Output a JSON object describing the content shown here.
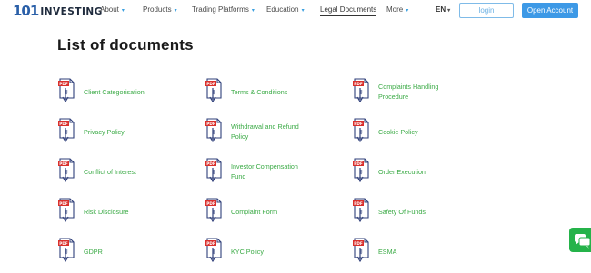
{
  "brand": {
    "number": "101",
    "word": "INVESTING"
  },
  "nav": [
    {
      "label": "About",
      "caret": "▾"
    },
    {
      "label": "Products",
      "caret": "▾"
    },
    {
      "label": "Trading Platforms",
      "caret": "▾"
    },
    {
      "label": "Education",
      "caret": "▾"
    },
    {
      "label": "Legal Documents",
      "caret": ""
    },
    {
      "label": "More",
      "caret": "▾"
    }
  ],
  "language": {
    "label": "EN",
    "caret": "▾"
  },
  "login_label": "login",
  "open_account_label": "Open Account",
  "page_title": "List of documents",
  "pdf_badge": "PDF",
  "documents": [
    [
      "Client Categorisation"
    ],
    [
      "Terms & Conditions"
    ],
    [
      "Complaints Handling",
      "Procedure"
    ],
    [
      "Privacy Policy"
    ],
    [
      "Withdrawal and Refund",
      "Policy"
    ],
    [
      "Cookie Policy"
    ],
    [
      "Conflict of Interest"
    ],
    [
      "Investor Compensation",
      "Fund"
    ],
    [
      "Order Execution"
    ],
    [
      "Risk Disclosure"
    ],
    [
      "Complaint Form"
    ],
    [
      "Safety Of Funds"
    ],
    [
      "GDPR"
    ],
    [
      "KYC Policy"
    ],
    [
      "ESMA"
    ]
  ],
  "colors": {
    "accent": "#3d99e6",
    "link_green": "#3aaa45",
    "pdf_red": "#d9302c",
    "icon_blue": "#2f3f7a",
    "chat_green": "#25b34a"
  },
  "icons": {
    "document": "pdf-download-icon",
    "chat": "chat-icon"
  }
}
